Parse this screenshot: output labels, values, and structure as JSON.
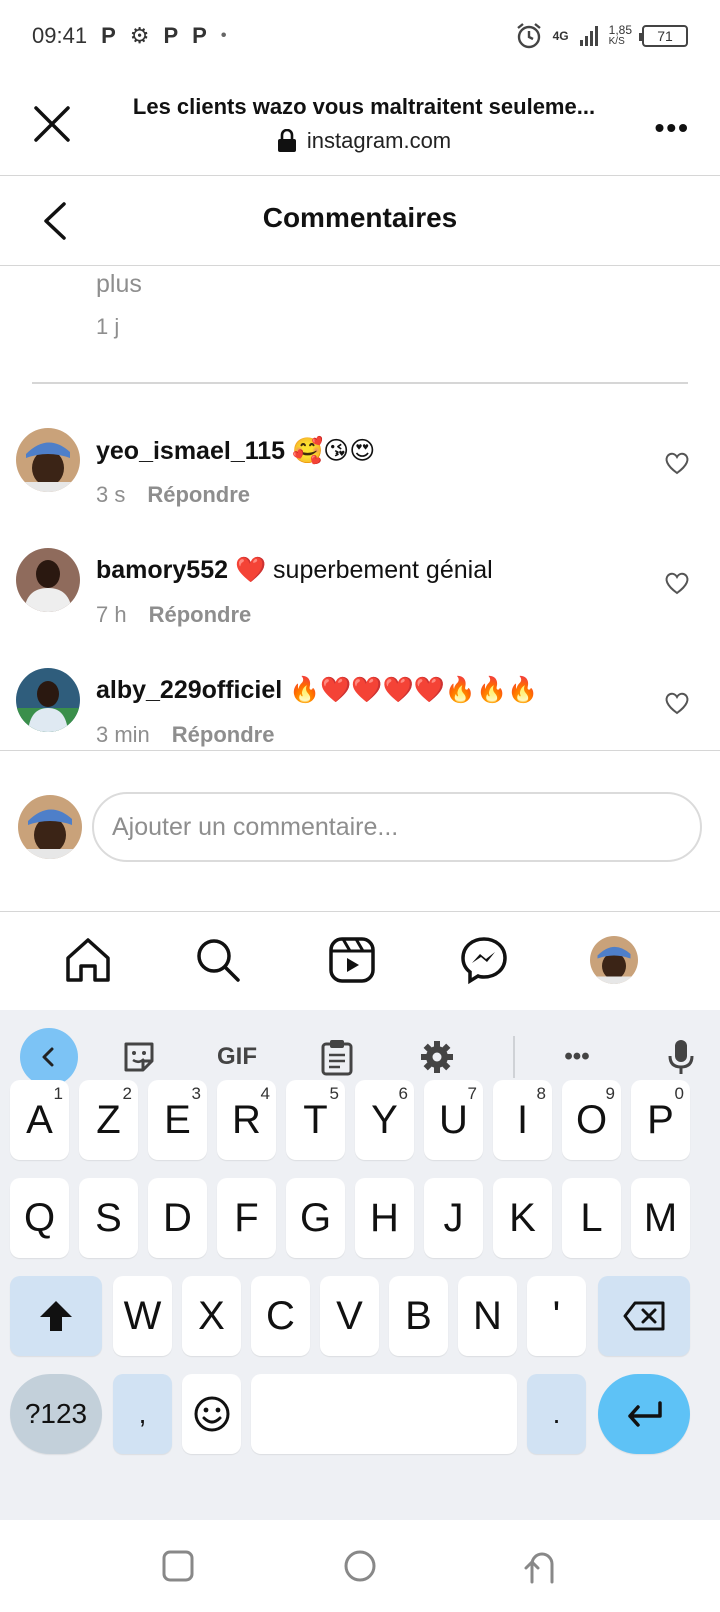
{
  "status": {
    "time": "09:41",
    "notifications": [
      "P",
      "⚙",
      "P",
      "P",
      "•"
    ],
    "network": "4G",
    "speed_value": "1,85",
    "speed_unit": "K/S",
    "battery": "71"
  },
  "browser": {
    "title": "Les clients wazo vous maltraitent seuleme...",
    "url": "instagram.com",
    "menu": "•••"
  },
  "comments_header": {
    "title": "Commentaires"
  },
  "previous_comment": {
    "more": "plus",
    "time": "1 j"
  },
  "comments": [
    {
      "username": "yeo_ismael_115",
      "text": "🥰😘😍",
      "time": "3 s",
      "reply": "Répondre"
    },
    {
      "username": "bamory552",
      "text": "❤️ superbement génial",
      "time": "7 h",
      "reply": "Répondre"
    },
    {
      "username": "alby_229officiel",
      "text": "🔥❤️❤️❤️❤️🔥🔥🔥",
      "time": "3 min",
      "reply": "Répondre"
    }
  ],
  "composer": {
    "placeholder": "Ajouter un commentaire..."
  },
  "keyboard": {
    "toolbar_gif": "GIF",
    "toolbar_more": "•••",
    "row1": [
      {
        "k": "A",
        "s": "1"
      },
      {
        "k": "Z",
        "s": "2"
      },
      {
        "k": "E",
        "s": "3"
      },
      {
        "k": "R",
        "s": "4"
      },
      {
        "k": "T",
        "s": "5"
      },
      {
        "k": "Y",
        "s": "6"
      },
      {
        "k": "U",
        "s": "7"
      },
      {
        "k": "I",
        "s": "8"
      },
      {
        "k": "O",
        "s": "9"
      },
      {
        "k": "P",
        "s": "0"
      }
    ],
    "row2": [
      "Q",
      "S",
      "D",
      "F",
      "G",
      "H",
      "J",
      "K",
      "L",
      "M"
    ],
    "row3": [
      "W",
      "X",
      "C",
      "V",
      "B",
      "N",
      "'"
    ],
    "sym": "?123",
    "comma": ",",
    "period": "."
  },
  "colors": {
    "accent": "#5ec2f6",
    "func_key": "#d1e2f3",
    "muted_text": "#8e8e8e"
  }
}
